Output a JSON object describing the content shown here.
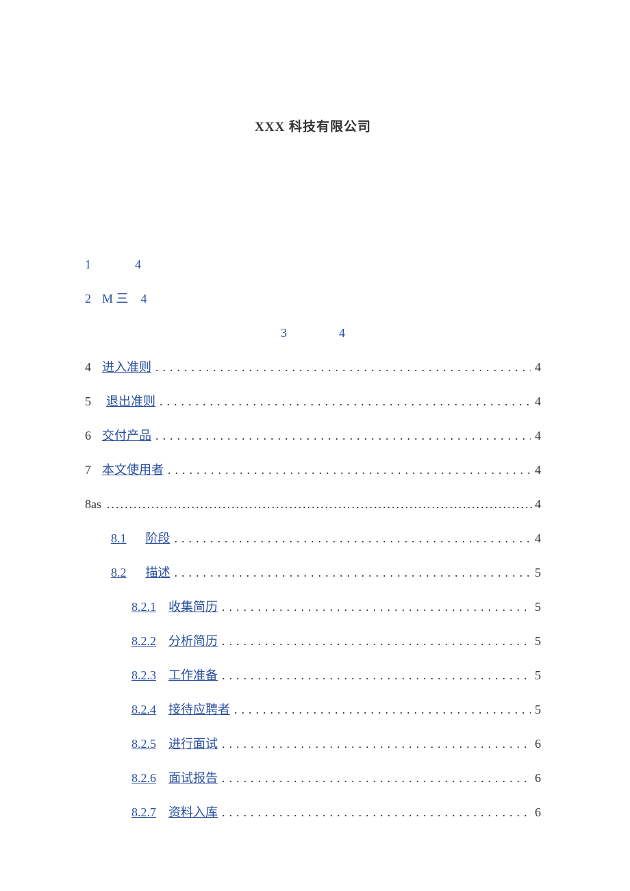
{
  "title": "XXX 科技有限公司",
  "entries": {
    "e1": {
      "num": "1",
      "page": "4"
    },
    "e2": {
      "num": "2",
      "label": "M 三",
      "page": "4"
    },
    "e3": {
      "num": "3",
      "page": "4"
    },
    "e4": {
      "num": "4",
      "label": "进入准则",
      "page": "4"
    },
    "e5": {
      "num": "5",
      "label": "退出准则",
      "page": "4"
    },
    "e6": {
      "num": "6",
      "label": "交付产品",
      "page": "4"
    },
    "e7": {
      "num": "7",
      "label": "本文使用者",
      "page": "4"
    },
    "e8": {
      "num": "8as",
      "page": "4"
    },
    "e81": {
      "num": "8.1",
      "label": "阶段",
      "page": "4"
    },
    "e82": {
      "num": "8.2",
      "label": "描述",
      "page": "5"
    },
    "e821": {
      "num": "8.2.1",
      "label": "收集简历",
      "page": "5"
    },
    "e822": {
      "num": "8.2.2",
      "label": "分析简历",
      "page": "5"
    },
    "e823": {
      "num": "8.2.3",
      "label": "工作准备",
      "page": "5"
    },
    "e824": {
      "num": "8.2.4",
      "label": "接待应聘者",
      "page": "5"
    },
    "e825": {
      "num": "8.2.5",
      "label": "进行面试",
      "page": "6"
    },
    "e826": {
      "num": "8.2.6",
      "label": "面试报告",
      "page": "6"
    },
    "e827": {
      "num": "8.2.7",
      "label": "资料入库",
      "page": "6"
    }
  }
}
